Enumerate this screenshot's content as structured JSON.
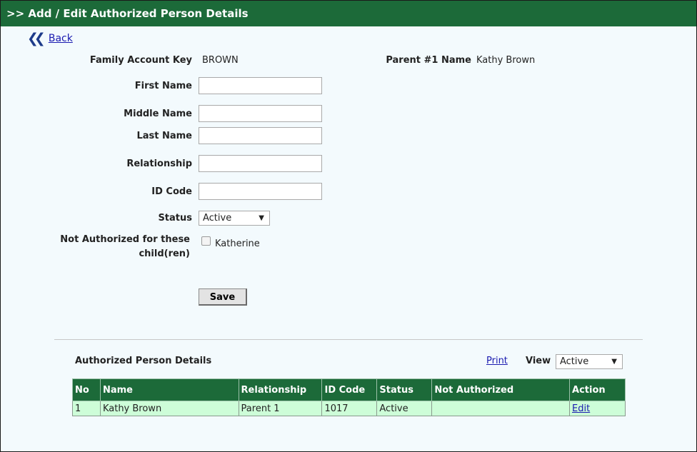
{
  "header": {
    "title": ">> Add / Edit Authorized Person Details"
  },
  "nav": {
    "back_label": "Back"
  },
  "account": {
    "family_key_label": "Family Account Key",
    "family_key_value": "BROWN",
    "parent1_label": "Parent #1 Name",
    "parent1_value": "Kathy Brown"
  },
  "form": {
    "first_name_label": "First Name",
    "first_name_value": "",
    "middle_name_label": "Middle Name",
    "middle_name_value": "",
    "last_name_label": "Last Name",
    "last_name_value": "",
    "relationship_label": "Relationship",
    "relationship_value": "",
    "id_code_label": "ID Code",
    "id_code_value": "",
    "status_label": "Status",
    "status_value": "Active",
    "not_authorized_label_line1": "Not Authorized for these",
    "not_authorized_label_line2": "child(ren)",
    "children": [
      {
        "name": "Katherine",
        "checked": false
      }
    ],
    "save_label": "Save"
  },
  "list": {
    "title": "Authorized Person Details",
    "print_label": "Print",
    "view_label": "View",
    "view_value": "Active",
    "columns": [
      "No",
      "Name",
      "Relationship",
      "ID Code",
      "Status",
      "Not Authorized",
      "Action"
    ],
    "rows": [
      {
        "no": "1",
        "name": "Kathy Brown",
        "relationship": "Parent 1",
        "id_code": "1017",
        "status": "Active",
        "not_authorized": "",
        "action": "Edit"
      }
    ]
  },
  "icons": {
    "back": "double-chevron-left-icon",
    "dropdown": "caret-down-icon"
  },
  "colors": {
    "header_bg": "#1c6a39",
    "row_bg": "#cdfdd8",
    "page_bg": "#f3fafd",
    "link": "#1a1ab0"
  }
}
